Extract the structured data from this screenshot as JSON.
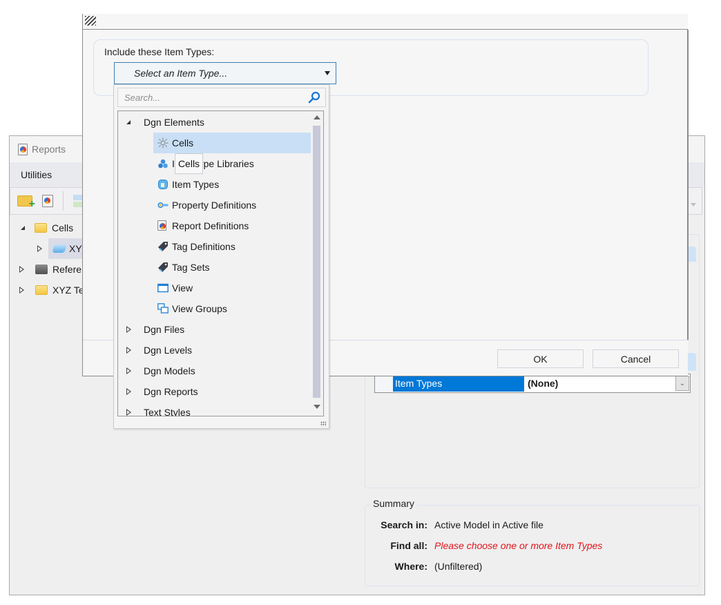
{
  "reports_window": {
    "title": "Reports",
    "menu": [
      "Utilities"
    ],
    "toolbar": {
      "buttons": [
        {
          "name": "new-folder",
          "icon": "folder-add-icon"
        },
        {
          "name": "new-report",
          "icon": "report-new-icon"
        },
        {
          "name": "grid-view",
          "icon": "grid-icon"
        }
      ]
    },
    "tree": [
      {
        "label": "Cells",
        "expanded": true,
        "icon": "folder-icon",
        "level": 0
      },
      {
        "label": "XYZ",
        "expanded": false,
        "icon": "cell-icon",
        "level": 1,
        "selected": true
      },
      {
        "label": "Refere",
        "expanded": false,
        "icon": "folder-dark-icon",
        "level": 0
      },
      {
        "label": "XYZ Te",
        "expanded": false,
        "icon": "folder-icon",
        "level": 0
      }
    ],
    "property_grid": {
      "name": "Item Types",
      "value": "(None)"
    },
    "summary": {
      "legend": "Summary",
      "rows": [
        {
          "label": "Search in:",
          "value": "Active Model  in Active file",
          "error": false
        },
        {
          "label": "Find all:",
          "value": "Please choose one or more Item Types",
          "error": true
        },
        {
          "label": "Where:",
          "value": "(Unfiltered)",
          "error": false
        }
      ]
    }
  },
  "dialog": {
    "include_label": "Include these Item Types:",
    "select": {
      "placeholder": "Select an Item Type..."
    },
    "buttons": {
      "ok": "OK",
      "cancel": "Cancel"
    }
  },
  "popup": {
    "search_placeholder": "Search...",
    "tooltip": "Cells",
    "tree": [
      {
        "label": "Dgn Elements",
        "expanded": true,
        "children": [
          {
            "label": "Cells",
            "icon": "sun-icon",
            "selected": true
          },
          {
            "label": "Item Type Libraries",
            "icon": "library-icon"
          },
          {
            "label": "Item Types",
            "icon": "item-type-cube-icon"
          },
          {
            "label": "Property Definitions",
            "icon": "key-icon"
          },
          {
            "label": "Report Definitions",
            "icon": "report-icon"
          },
          {
            "label": "Tag Definitions",
            "icon": "tag-icon"
          },
          {
            "label": "Tag Sets",
            "icon": "tag-icon"
          },
          {
            "label": "View",
            "icon": "window-icon"
          },
          {
            "label": "View Groups",
            "icon": "view-groups-icon"
          }
        ]
      },
      {
        "label": "Dgn Files",
        "expanded": false
      },
      {
        "label": "Dgn Levels",
        "expanded": false
      },
      {
        "label": "Dgn Models",
        "expanded": false
      },
      {
        "label": "Dgn Reports",
        "expanded": false
      },
      {
        "label": "Text Styles",
        "expanded": false
      }
    ]
  },
  "colors": {
    "accent": "#0078d7",
    "selection": "#c9dff5",
    "error": "#e2141c",
    "select_border": "#3c7fb1"
  }
}
